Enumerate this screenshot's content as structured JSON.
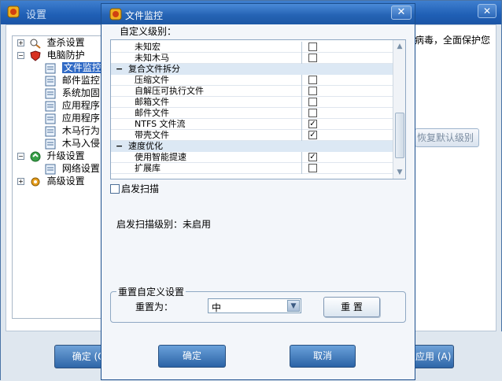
{
  "background_window": {
    "title": "设置",
    "close_glyph": "✕",
    "tree": [
      {
        "label": "查杀设置",
        "expander": "+",
        "icon": "scan-icon",
        "level": 0
      },
      {
        "label": "电脑防护",
        "expander": "−",
        "icon": "shield-icon",
        "level": 0
      },
      {
        "label": "文件监控",
        "icon": "page-icon",
        "level": 1,
        "selected": true
      },
      {
        "label": "邮件监控",
        "icon": "page-icon",
        "level": 1
      },
      {
        "label": "系统加固",
        "icon": "page-icon",
        "level": 1
      },
      {
        "label": "应用程序",
        "icon": "page-icon",
        "level": 1
      },
      {
        "label": "应用程序",
        "icon": "page-icon",
        "level": 1
      },
      {
        "label": "木马行为",
        "icon": "page-icon",
        "level": 1
      },
      {
        "label": "木马入侵",
        "icon": "page-icon",
        "level": 1
      },
      {
        "label": "升级设置",
        "expander": "−",
        "icon": "update-icon",
        "level": 0
      },
      {
        "label": "网络设置",
        "icon": "page-icon",
        "level": 1
      },
      {
        "label": "高级设置",
        "expander": "+",
        "icon": "gear-icon",
        "level": 0
      }
    ],
    "info_text": "病毒，全面保护您",
    "restore_default_button": "恢复默认级别",
    "ok_button": "确定 (O)",
    "apply_button": "应用 (A)"
  },
  "dialog": {
    "title": "文件监控",
    "close_glyph": "✕",
    "custom_level_label": "自定义级别：",
    "list_rows": [
      {
        "type": "item",
        "label": "未知宏",
        "checked": false
      },
      {
        "type": "item",
        "label": "未知木马",
        "checked": false
      },
      {
        "type": "group",
        "label": "复合文件拆分",
        "expander": "−"
      },
      {
        "type": "item",
        "label": "压缩文件",
        "checked": false
      },
      {
        "type": "item",
        "label": "自解压可执行文件",
        "checked": false
      },
      {
        "type": "item",
        "label": "邮箱文件",
        "checked": false
      },
      {
        "type": "item",
        "label": "邮件文件",
        "checked": false
      },
      {
        "type": "item",
        "label": "NTFS 文件流",
        "checked": true
      },
      {
        "type": "item",
        "label": "带壳文件",
        "checked": true
      },
      {
        "type": "group",
        "label": "速度优化",
        "expander": "−"
      },
      {
        "type": "item",
        "label": "使用智能提速",
        "checked": true
      },
      {
        "type": "item",
        "label": "扩展库",
        "checked": false
      }
    ],
    "heuristic_checkbox_label": "启发扫描",
    "heuristic_checked": false,
    "heuristic_level_text": "启发扫描级别：未启用",
    "reset_group_title": "重置自定义设置",
    "reset_to_label": "重置为：",
    "reset_combo_value": "中",
    "reset_button": "重 置",
    "ok_button": "确定",
    "cancel_button": "取消"
  },
  "colors": {
    "titlebar_blue": "#2563b4",
    "group_row_bg": "#dce8f4",
    "selected_bg": "#316ac5"
  }
}
